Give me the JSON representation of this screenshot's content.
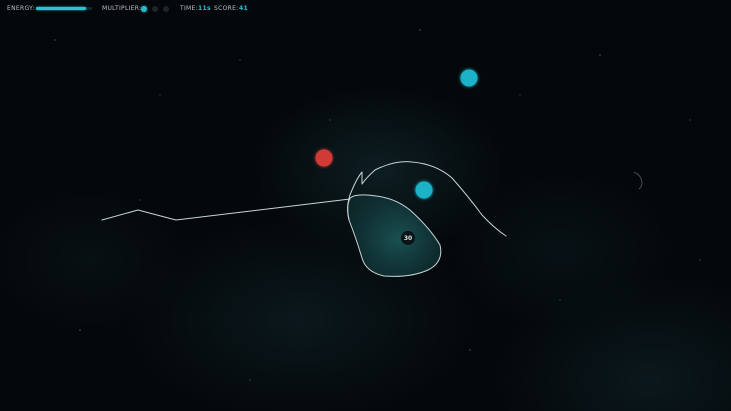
{
  "hud": {
    "energy_label": "ENERGY:",
    "energy_level": 0.9,
    "multiplier_label": "MULTIPLIER:",
    "multiplier_active": 1,
    "multiplier_total": 3,
    "time_label": "TIME:",
    "time_value": "11s",
    "score_label": "SCORE:",
    "score_value": "41"
  },
  "colors": {
    "accent": "#2bc0d4",
    "orb_cyan": "#1ab3c8",
    "orb_red": "#d23a36",
    "trail": "#c7d3d6",
    "enclosed_fill": "#1f6f73"
  },
  "field": {
    "enclosed_counter": "30",
    "orbs": [
      {
        "kind": "cyan"
      },
      {
        "kind": "red"
      },
      {
        "kind": "cyan"
      }
    ]
  }
}
